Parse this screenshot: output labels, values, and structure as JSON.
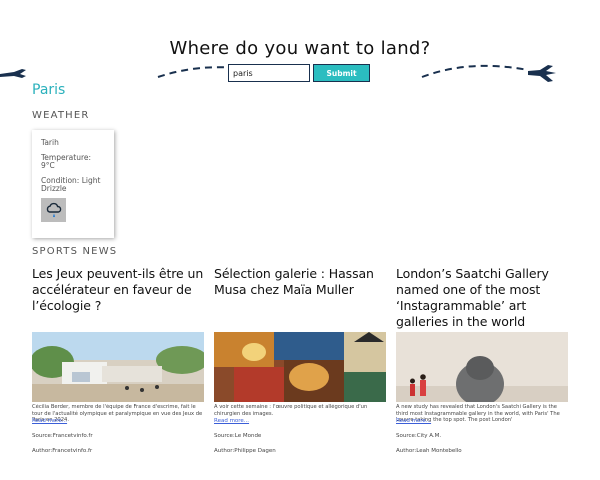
{
  "hero": {
    "title": "Where do you want to land?",
    "search_value": "paris",
    "submit_label": "Submit"
  },
  "city": "Paris",
  "weather": {
    "section_label": "WEATHER",
    "date_line": "Tarih",
    "temperature_line": "Temperature: 9°C",
    "condition_line": "Condition: Light Drizzle",
    "icon": "rain-cloud-icon"
  },
  "sports": {
    "section_label": "SPORTS NEWS",
    "articles": [
      {
        "title": "Les Jeux peuvent-ils être un accélérateur en faveur de l’écologie ?",
        "description": "Cécilia Berder, membre de l'équipe de France d'escrime, fait le tour de l'actualité olympique et paralympique en vue des Jeux de Paris en 2024.",
        "read_more": "Read more...",
        "source": "Source:Francetvinfo.fr",
        "author": "Author:Francetvinfo.fr"
      },
      {
        "title": "Sélection galerie : Hassan Musa chez Maïa Muller",
        "description": "A voir cette semaine : l'œuvre politique et allégorique d'un chirurgien des images.",
        "read_more": "Read more...",
        "source": "Source:Le Monde",
        "author": "Author:Philippe Dagen"
      },
      {
        "title": "London’s Saatchi Gallery named one of the most ‘Instagrammable’ art galleries in the world",
        "description": "A new study has revealed that London's Saatchi Gallery is the third most Instagrammable gallery in the world, with Paris' The Louvre taking the top spot. The post London'",
        "read_more": "Read more...",
        "source": "Source:City A.M.",
        "author": "Author:Leah Montebello"
      }
    ]
  },
  "colors": {
    "accent": "#2bbdc0",
    "navy": "#19304e",
    "link": "#3b5ed8"
  }
}
